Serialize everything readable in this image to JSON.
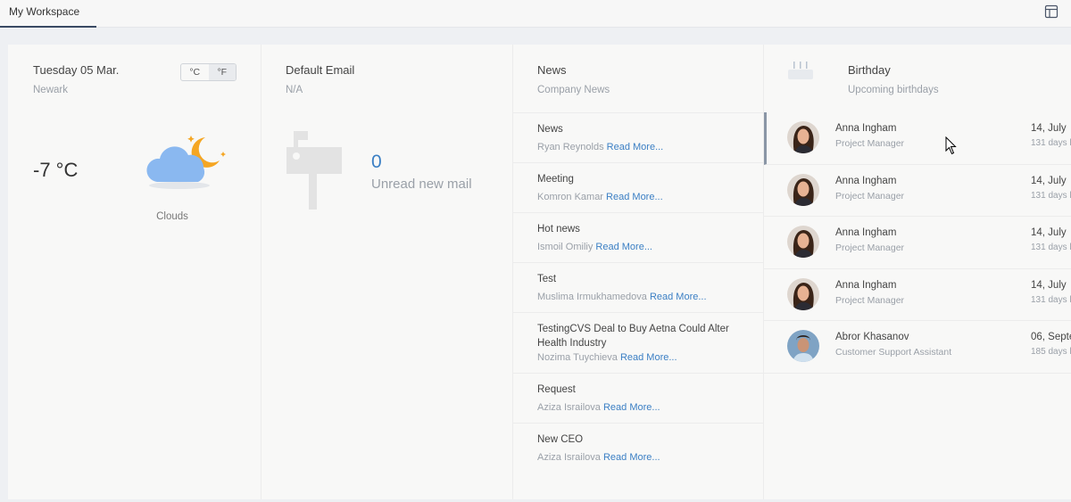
{
  "tabs": [
    {
      "label": "My Workspace",
      "active": true
    }
  ],
  "weather": {
    "date": "Tuesday 05 Mar.",
    "city": "Newark",
    "units": [
      "°C",
      "°F"
    ],
    "active_unit": "°F",
    "temperature": "-7 °C",
    "condition": "Clouds",
    "icon": "cloud-moon-icon"
  },
  "email": {
    "title": "Default Email",
    "address": "N/A",
    "unread_count": "0",
    "unread_label": "Unread new mail",
    "icon": "mailbox-icon"
  },
  "news": {
    "title": "News",
    "subtitle": "Company News",
    "read_more": "Read More...",
    "items": [
      {
        "title": "News",
        "author": "Ryan Reynolds"
      },
      {
        "title": "Meeting",
        "author": "Komron Kamar"
      },
      {
        "title": "Hot news",
        "author": "Ismoil Omiliy"
      },
      {
        "title": "Test",
        "author": "Muslima Irmukhamedova"
      },
      {
        "title": "TestingCVS Deal to Buy Aetna Could Alter Health Industry",
        "author": "Nozima Tuychieva"
      },
      {
        "title": "Request",
        "author": "Aziza Israilova"
      },
      {
        "title": "New CEO",
        "author": "Aziza Israilova"
      }
    ]
  },
  "birthday": {
    "title": "Birthday",
    "subtitle": "Upcoming birthdays",
    "icon": "cake-icon",
    "people": [
      {
        "name": "Anna Ingham",
        "role": "Project Manager",
        "date": "14, July",
        "days": "131 days l"
      },
      {
        "name": "Anna Ingham",
        "role": "Project Manager",
        "date": "14, July",
        "days": "131 days l"
      },
      {
        "name": "Anna Ingham",
        "role": "Project Manager",
        "date": "14, July",
        "days": "131 days l"
      },
      {
        "name": "Anna Ingham",
        "role": "Project Manager",
        "date": "14, July",
        "days": "131 days l"
      },
      {
        "name": "Abror Khasanov",
        "role": "Customer Support Assistant",
        "date": "06, Septe",
        "days": "185 days l"
      }
    ]
  },
  "colors": {
    "accent": "#3b7fc4",
    "cloud": "#8ab8f0",
    "moon": "#f5a623",
    "tab_underline": "#3a4a63"
  }
}
